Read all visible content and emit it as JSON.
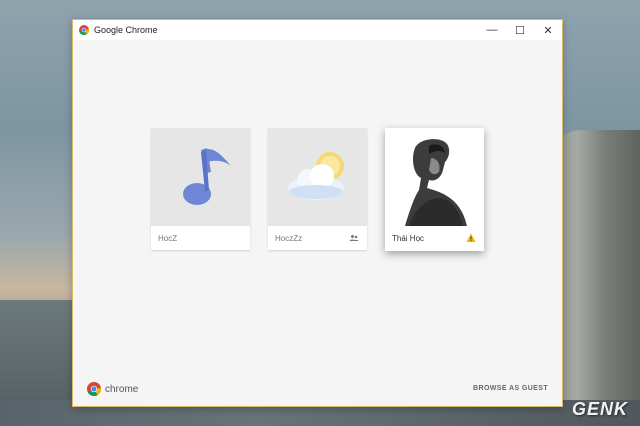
{
  "window": {
    "title": "Google Chrome",
    "controls": {
      "minimize": "—",
      "maximize": "☐",
      "close": "✕"
    }
  },
  "profiles": [
    {
      "name": "HocZ",
      "avatar": "music-note-icon",
      "badge": ""
    },
    {
      "name": "HoczZz",
      "avatar": "cloud-sun-icon",
      "badge": "supervised-user-icon"
    },
    {
      "name": "Thái Học",
      "avatar": "user-photo",
      "badge": "warning-icon"
    }
  ],
  "footer": {
    "logo_label": "chrome",
    "guest_label": "BROWSE AS GUEST"
  },
  "watermark": "GENK",
  "colors": {
    "window_border": "#d9b76b",
    "warning": "#f4b400",
    "note": "#6f86d6"
  }
}
